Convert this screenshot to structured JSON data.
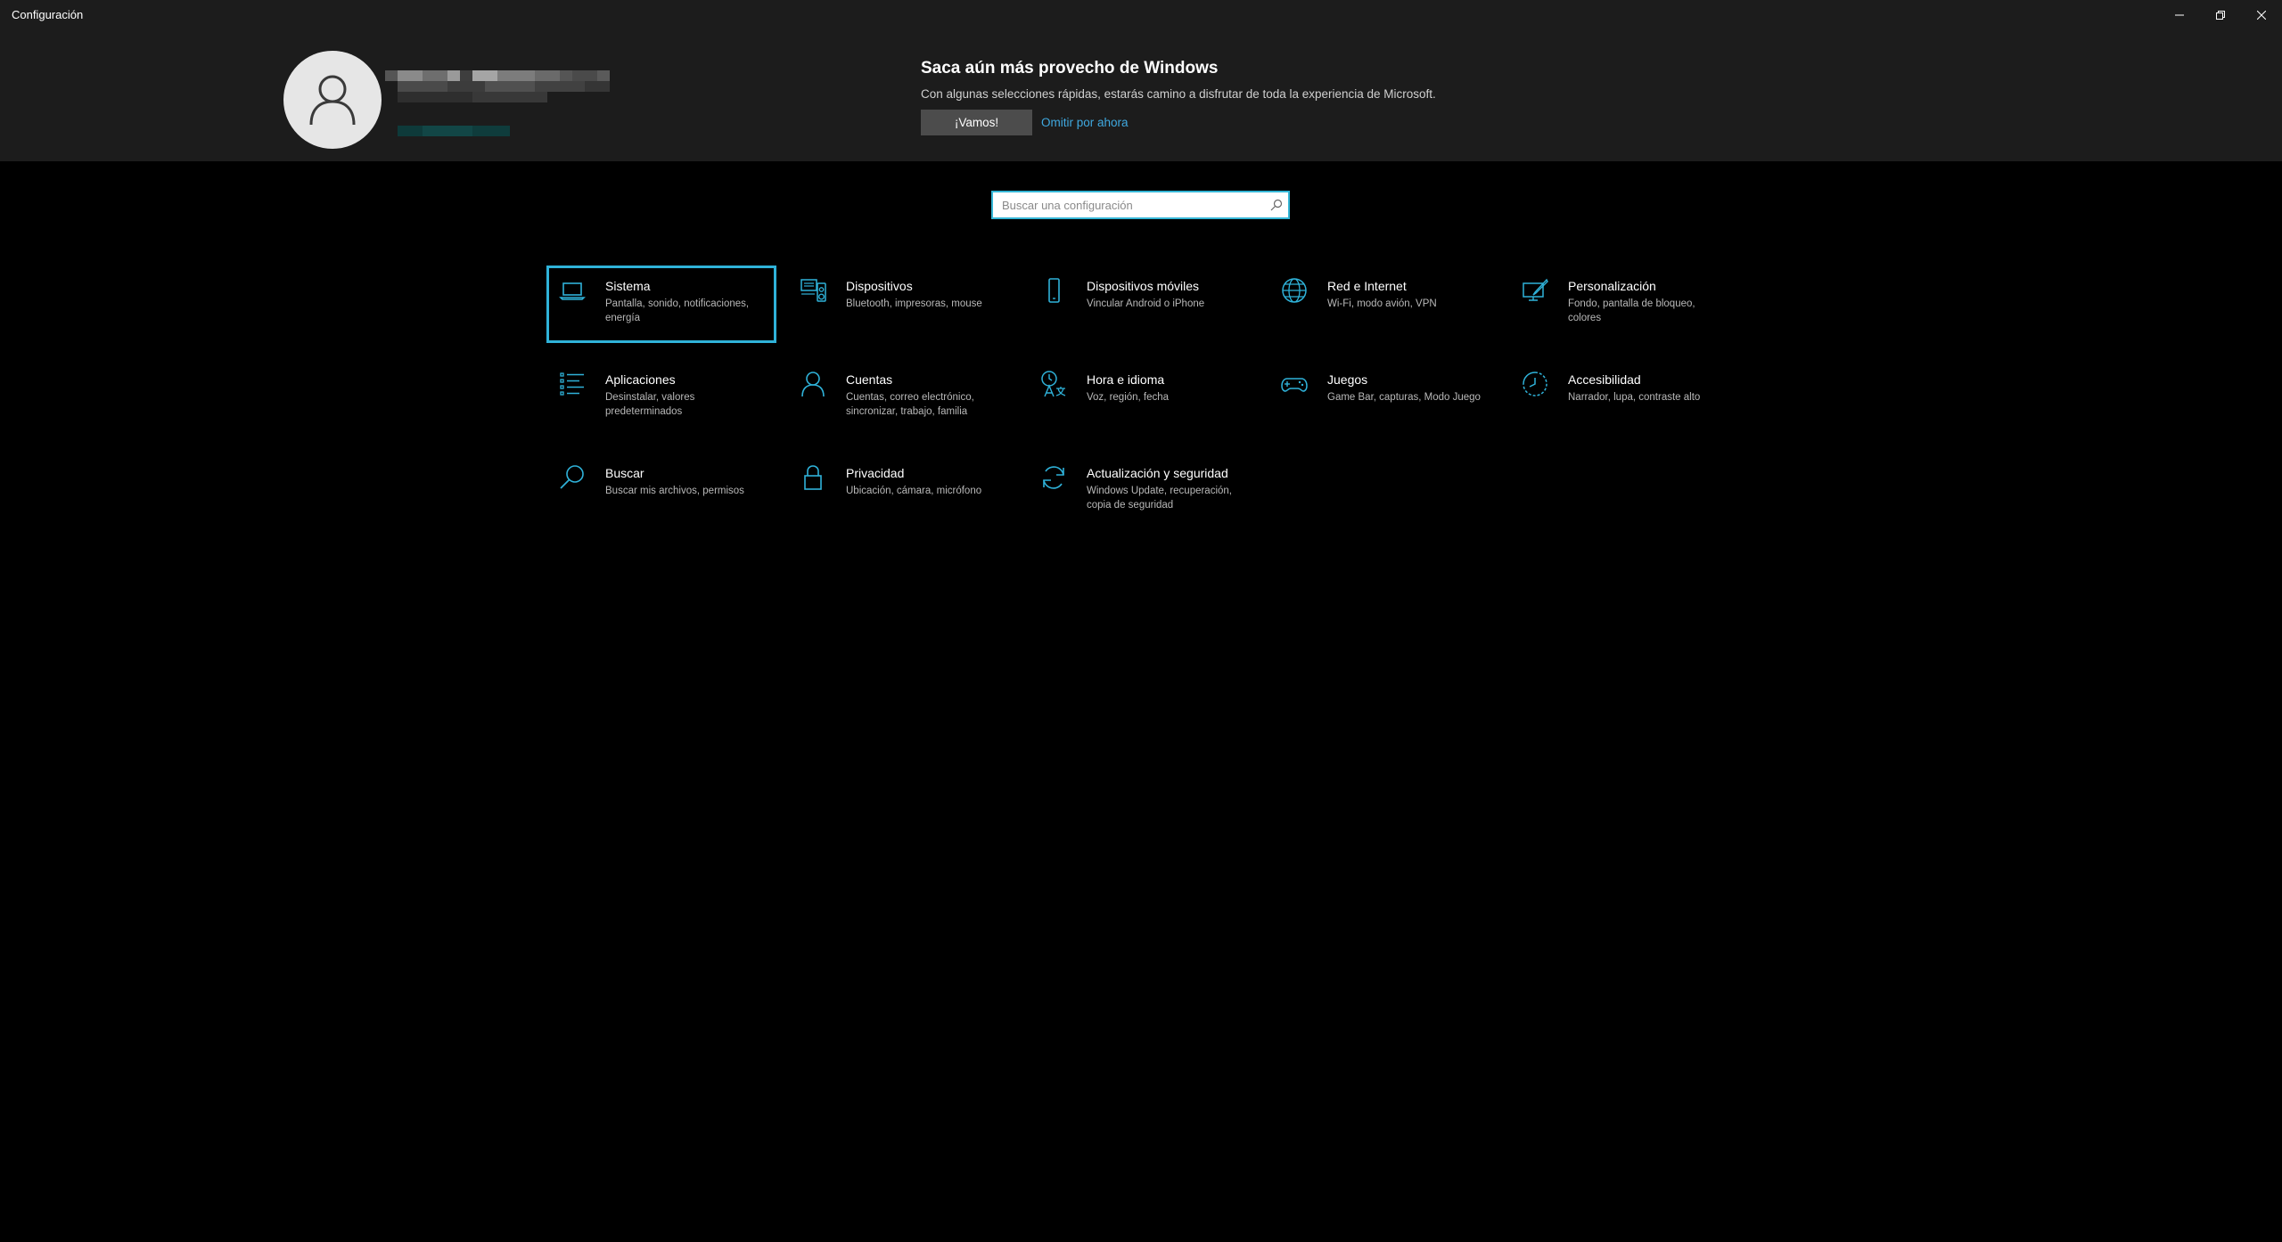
{
  "window": {
    "title": "Configuración"
  },
  "promo": {
    "title": "Saca aún más provecho de Windows",
    "description": "Con algunas selecciones rápidas, estarás camino a disfrutar de toda la experiencia de Microsoft.",
    "primary_label": "¡Vamos!",
    "secondary_label": "Omitir por ahora"
  },
  "search": {
    "placeholder": "Buscar una configuración"
  },
  "colors": {
    "accent": "#2fb2d9",
    "link": "#3fa9e0",
    "header_bg": "#1c1c1c",
    "page_bg": "#000000"
  },
  "categories": [
    {
      "label": "Sistema",
      "desc": "Pantalla, sonido, notificaciones, energía",
      "icon": "laptop-icon"
    },
    {
      "label": "Dispositivos",
      "desc": "Bluetooth, impresoras, mouse",
      "icon": "devices-icon"
    },
    {
      "label": "Dispositivos móviles",
      "desc": "Vincular Android o iPhone",
      "icon": "phone-icon"
    },
    {
      "label": "Red e Internet",
      "desc": "Wi-Fi, modo avión, VPN",
      "icon": "globe-icon"
    },
    {
      "label": "Personalización",
      "desc": "Fondo, pantalla de bloqueo, colores",
      "icon": "personalization-icon"
    },
    {
      "label": "Aplicaciones",
      "desc": "Desinstalar, valores predeterminados",
      "icon": "apps-list-icon"
    },
    {
      "label": "Cuentas",
      "desc": "Cuentas, correo electrónico, sincronizar, trabajo, familia",
      "icon": "person-icon"
    },
    {
      "label": "Hora e idioma",
      "desc": "Voz, región, fecha",
      "icon": "time-language-icon"
    },
    {
      "label": "Juegos",
      "desc": "Game Bar, capturas, Modo Juego",
      "icon": "gamepad-icon"
    },
    {
      "label": "Accesibilidad",
      "desc": "Narrador, lupa, contraste alto",
      "icon": "accessibility-icon"
    },
    {
      "label": "Buscar",
      "desc": "Buscar mis archivos, permisos",
      "icon": "search-icon"
    },
    {
      "label": "Privacidad",
      "desc": "Ubicación, cámara, micrófono",
      "icon": "lock-icon"
    },
    {
      "label": "Actualización y seguridad",
      "desc": "Windows Update, recuperación, copia de seguridad",
      "icon": "sync-icon"
    }
  ]
}
